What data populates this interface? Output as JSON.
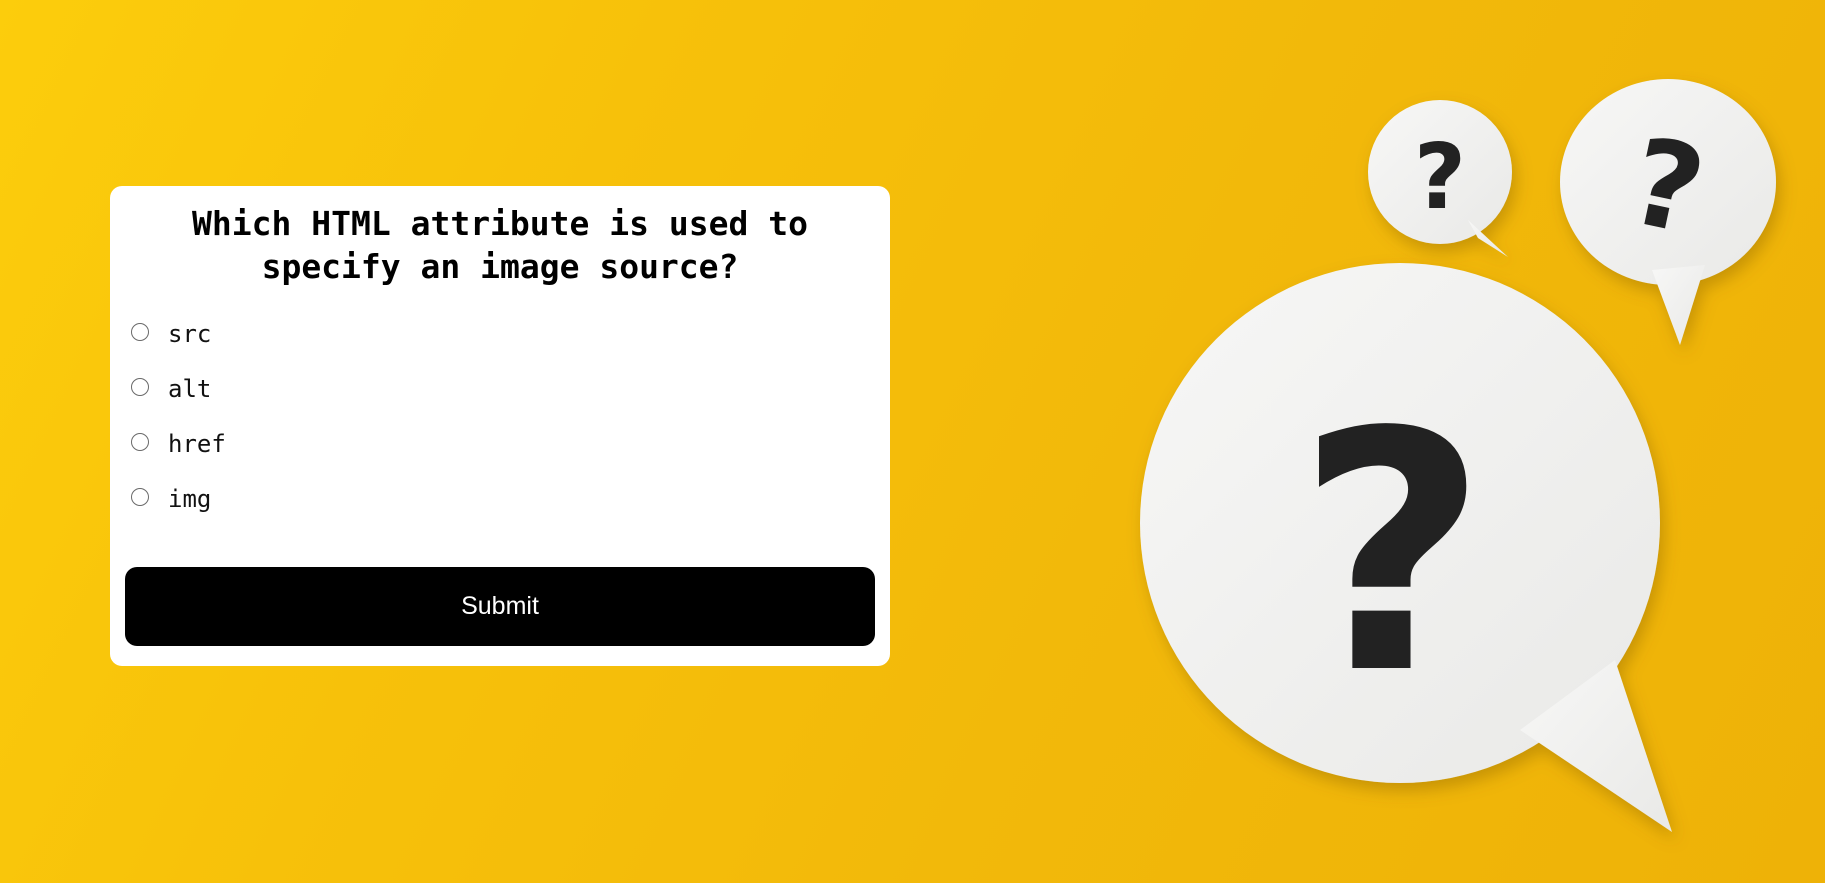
{
  "quiz": {
    "question": "Which HTML attribute is used to specify an image source?",
    "options": [
      {
        "label": "src",
        "selected": false
      },
      {
        "label": "alt",
        "selected": false
      },
      {
        "label": "href",
        "selected": false
      },
      {
        "label": "img",
        "selected": false
      }
    ],
    "submit_label": "Submit"
  },
  "illustration": {
    "background_color": "#f2b90a",
    "bubble_color": "#f2f2f1",
    "mark_color": "#222222",
    "icons": [
      "speech-bubble-question-icon",
      "speech-bubble-question-icon",
      "speech-bubble-question-icon"
    ],
    "glyph": "?"
  },
  "colors": {
    "card": "#ffffff",
    "button": "#000000",
    "button_text": "#ffffff"
  }
}
